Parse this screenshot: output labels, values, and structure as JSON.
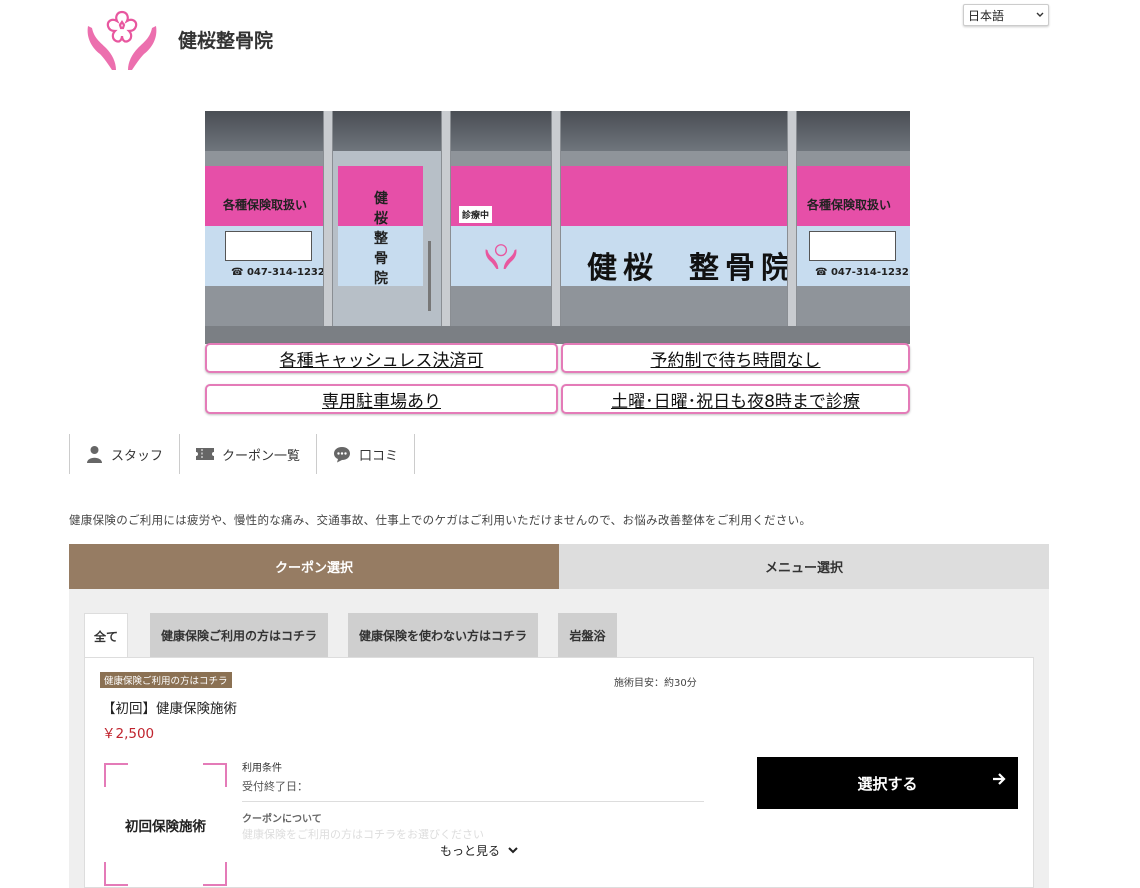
{
  "header": {
    "clinic_name": "健桜整骨院",
    "language": "日本語"
  },
  "hero": {
    "sign_left": "各種保険取扱い",
    "sign_right": "各種保険取扱い",
    "phone": "☎ 047-314-1232",
    "door_name": [
      "健",
      "桜",
      "整",
      "骨",
      "院"
    ],
    "door_sign": "診療中",
    "big_name_left": "健桜",
    "big_name_right": "整骨院"
  },
  "features": [
    "各種キャッシュレス決済可",
    "予約制で待ち時間なし",
    "専用駐車場あり",
    "土曜･日曜･祝日も夜8時まで診療"
  ],
  "nav": {
    "staff": "スタッフ",
    "coupons": "クーポン一覧",
    "reviews": "口コミ"
  },
  "notice": "健康保険のご利用には疲労や、慢性的な痛み、交通事故、仕事上でのケガはご利用いただけませんので、お悩み改善整体をご利用ください。",
  "main_tabs": {
    "coupon": "クーポン選択",
    "menu": "メニュー選択"
  },
  "sub_tabs": [
    "全て",
    "健康保険ご利用の方はコチラ",
    "健康保険を使わない方はコチラ",
    "岩盤浴"
  ],
  "coupon": {
    "badge": "健康保険ご利用の方はコチラ",
    "duration": "施術目安：約30分",
    "title": "【初回】健康保険施術",
    "price": "￥2,500",
    "thumb_label": "初回保険施術",
    "conditions_label": "利用条件",
    "deadline": "受付終了日：",
    "about_label": "クーポンについて",
    "about_text": "健康保険をご利用の方はコチラをお選びください",
    "more": "もっと見る",
    "select": "選択する"
  },
  "colors": {
    "brand_brown": "#967c63",
    "accent_pink": "#e47bb8",
    "price_red": "#c0242e"
  }
}
